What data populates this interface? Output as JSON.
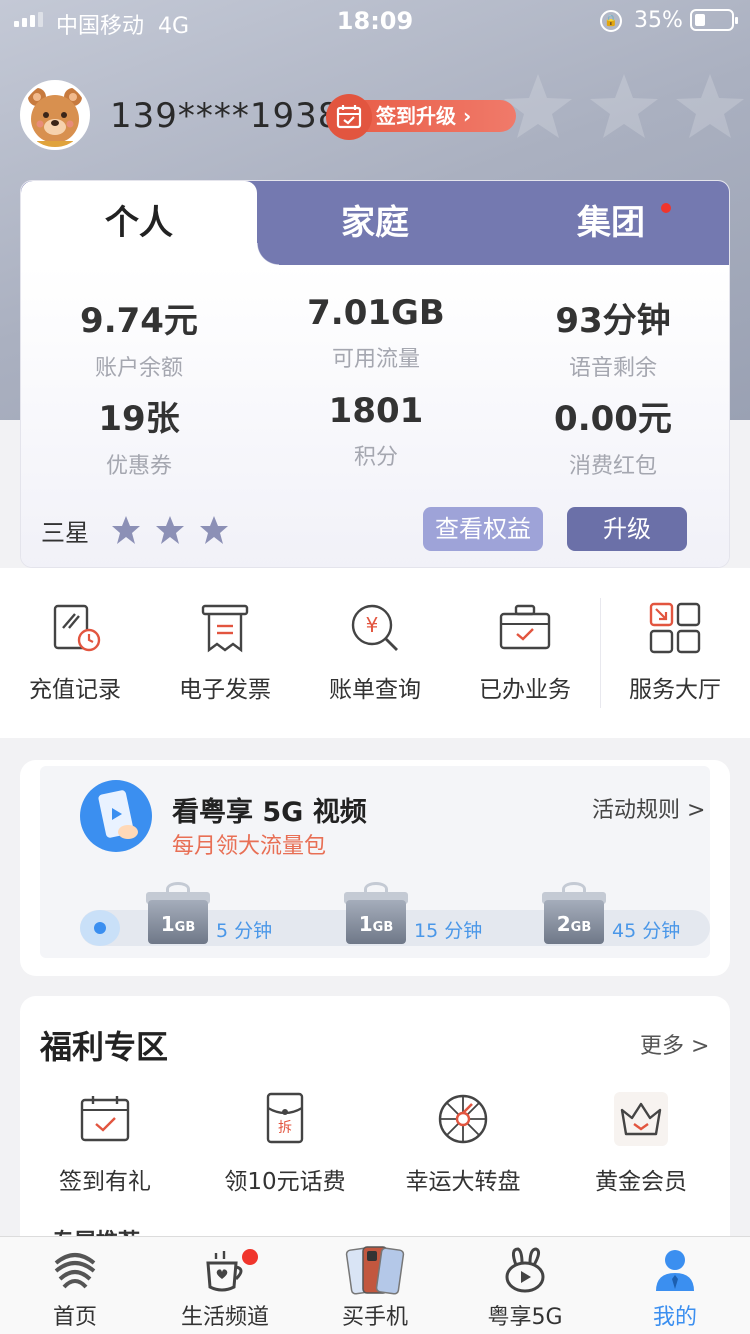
{
  "status_bar": {
    "carrier": "中国移动",
    "network": "4G",
    "time": "18:09",
    "battery": "35%"
  },
  "profile": {
    "phone": "139****1938",
    "signin_label": "签到升级",
    "signin_arrow": "›"
  },
  "account_tabs": [
    {
      "label": "个人",
      "active": true
    },
    {
      "label": "家庭",
      "active": false
    },
    {
      "label": "集团",
      "active": false,
      "has_dot": true
    }
  ],
  "stats": [
    {
      "value": "9.74元",
      "label": "账户余额"
    },
    {
      "value": "7.01GB",
      "label": "可用流量"
    },
    {
      "value": "93分钟",
      "label": "语音剩余"
    },
    {
      "value": "19张",
      "label": "优惠券"
    },
    {
      "value": "1801",
      "label": "积分"
    },
    {
      "value": "0.00元",
      "label": "消费红包"
    }
  ],
  "membership": {
    "level": "三星",
    "stars": 3,
    "benefits_button": "查看权益",
    "upgrade_button": "升级"
  },
  "quick_actions": [
    {
      "label": "充值记录",
      "icon": "recharge-record-icon"
    },
    {
      "label": "电子发票",
      "icon": "invoice-icon"
    },
    {
      "label": "账单查询",
      "icon": "bill-query-icon"
    },
    {
      "label": "已办业务",
      "icon": "business-done-icon"
    },
    {
      "label": "服务大厅",
      "icon": "service-hall-icon"
    }
  ],
  "video_promo": {
    "title": "看粤享 5G 视频",
    "subtitle": "每月领大流量包",
    "rules": "活动规则 >",
    "rewards": [
      {
        "amount": "1",
        "unit": "GB",
        "minutes": "5 分钟"
      },
      {
        "amount": "1",
        "unit": "GB",
        "minutes": "15 分钟"
      },
      {
        "amount": "2",
        "unit": "GB",
        "minutes": "45 分钟"
      }
    ]
  },
  "welfare": {
    "title": "福利专区",
    "more": "更多 >",
    "items": [
      {
        "label": "签到有礼",
        "icon": "calendar-check-icon"
      },
      {
        "label": "领10元话费",
        "icon": "red-envelope-icon"
      },
      {
        "label": "幸运大转盘",
        "icon": "wheel-icon"
      },
      {
        "label": "黄金会员",
        "icon": "crown-icon"
      }
    ],
    "peek_title": "专属推荐"
  },
  "tab_bar": [
    {
      "label": "首页",
      "icon": "china-mobile-logo-icon",
      "active": false
    },
    {
      "label": "生活频道",
      "icon": "cup-icon",
      "active": false,
      "has_dot": true
    },
    {
      "label": "买手机",
      "icon": "phone-icon",
      "active": false
    },
    {
      "label": "粤享5G",
      "icon": "rabbit-icon",
      "active": false
    },
    {
      "label": "我的",
      "icon": "user-icon",
      "active": true
    }
  ],
  "colors": {
    "tab_bar_active": "#3b8ff0",
    "card_tab_bg": "#7479b0",
    "accent_red": "#e2553f"
  }
}
